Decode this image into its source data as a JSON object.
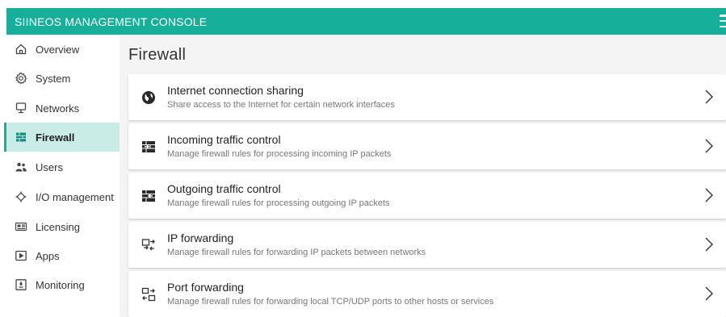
{
  "header": {
    "title": "SIINEOS MANAGEMENT CONSOLE",
    "menu_icon": "hamburger-icon",
    "color": "#16b09a"
  },
  "sidebar": {
    "items": [
      {
        "label": "Overview",
        "icon": "home-icon",
        "active": false
      },
      {
        "label": "System",
        "icon": "gear-icon",
        "active": false
      },
      {
        "label": "Networks",
        "icon": "network-icon",
        "active": false
      },
      {
        "label": "Firewall",
        "icon": "firewall-icon",
        "active": true
      },
      {
        "label": "Users",
        "icon": "users-icon",
        "active": false
      },
      {
        "label": "I/O management",
        "icon": "io-icon",
        "active": false
      },
      {
        "label": "Licensing",
        "icon": "license-icon",
        "active": false
      },
      {
        "label": "Apps",
        "icon": "apps-icon",
        "active": false
      },
      {
        "label": "Monitoring",
        "icon": "monitoring-icon",
        "active": false
      }
    ],
    "active_color": "#c9ece6"
  },
  "main": {
    "title": "Firewall",
    "cards": [
      {
        "title": "Internet connection sharing",
        "subtitle": "Share access to the Internet for certain network interfaces",
        "icon": "globe-icon"
      },
      {
        "title": "Incoming traffic control",
        "subtitle": "Manage firewall rules for processing incoming IP packets",
        "icon": "incoming-traffic-icon"
      },
      {
        "title": "Outgoing traffic control",
        "subtitle": "Manage firewall rules for processing outgoing IP packets",
        "icon": "outgoing-traffic-icon"
      },
      {
        "title": "IP forwarding",
        "subtitle": "Manage firewall rules for forwarding IP packets between networks",
        "icon": "ip-forwarding-icon"
      },
      {
        "title": "Port forwarding",
        "subtitle": "Manage firewall rules for forwarding local TCP/UDP ports to other hosts or services",
        "icon": "port-forwarding-icon"
      }
    ]
  }
}
